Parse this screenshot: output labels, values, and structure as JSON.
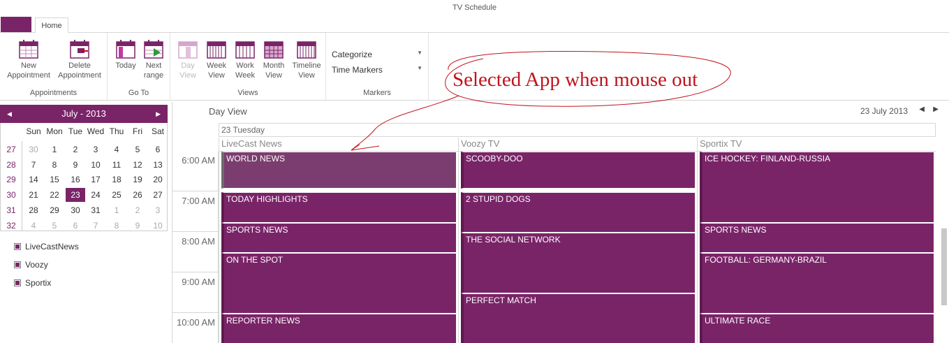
{
  "window": {
    "title": "TV Schedule"
  },
  "ribbon": {
    "tabs": [
      {
        "label": "Home"
      }
    ],
    "groups": {
      "appointments": {
        "label": "Appointments",
        "new_label": "New\nAppointment",
        "delete_label": "Delete\nAppointment"
      },
      "goto": {
        "label": "Go To",
        "today_label": "Today",
        "next_label": "Next\nrange"
      },
      "views": {
        "label": "Views",
        "day_label": "Day\nView",
        "week_label": "Week\nView",
        "workweek_label": "Work\nWeek",
        "month_label": "Month\nView",
        "timeline_label": "Timeline\nView"
      },
      "markers": {
        "label": "Markers",
        "categorize_label": "Categorize",
        "timemarkers_label": "Time Markers"
      }
    }
  },
  "mini_calendar": {
    "title": "July - 2013",
    "weekdays": [
      "Sun",
      "Mon",
      "Tue",
      "Wed",
      "Thu",
      "Fri",
      "Sat"
    ],
    "weeks": [
      {
        "num": "27",
        "days": [
          "30",
          "1",
          "2",
          "3",
          "4",
          "5",
          "6"
        ],
        "other": [
          true,
          false,
          false,
          false,
          false,
          false,
          false
        ]
      },
      {
        "num": "28",
        "days": [
          "7",
          "8",
          "9",
          "10",
          "11",
          "12",
          "13"
        ],
        "other": [
          false,
          false,
          false,
          false,
          false,
          false,
          false
        ]
      },
      {
        "num": "29",
        "days": [
          "14",
          "15",
          "16",
          "17",
          "18",
          "19",
          "20"
        ],
        "other": [
          false,
          false,
          false,
          false,
          false,
          false,
          false
        ]
      },
      {
        "num": "30",
        "days": [
          "21",
          "22",
          "23",
          "24",
          "25",
          "26",
          "27"
        ],
        "other": [
          false,
          false,
          false,
          false,
          false,
          false,
          false
        ]
      },
      {
        "num": "31",
        "days": [
          "28",
          "29",
          "30",
          "31",
          "1",
          "2",
          "3"
        ],
        "other": [
          false,
          false,
          false,
          false,
          true,
          true,
          true
        ]
      },
      {
        "num": "32",
        "days": [
          "4",
          "5",
          "6",
          "7",
          "8",
          "9",
          "10"
        ],
        "other": [
          true,
          true,
          true,
          true,
          true,
          true,
          true
        ]
      }
    ],
    "selected_day": "23"
  },
  "resources": [
    {
      "label": "LiveCastNews"
    },
    {
      "label": "Voozy"
    },
    {
      "label": "Sportix"
    }
  ],
  "scheduler": {
    "view_title": "Day View",
    "date_label": "23 July 2013",
    "day_header": "23 Tuesday",
    "columns": [
      {
        "name": "LiveCast News",
        "appointments": [
          {
            "title": "WORLD NEWS",
            "start": "6:00",
            "end": "6:55",
            "selected": true
          },
          {
            "title": "TODAY HIGHLIGHTS",
            "start": "7:00",
            "end": "7:45",
            "selected": false
          },
          {
            "title": "SPORTS NEWS",
            "start": "7:45",
            "end": "8:30",
            "selected": false
          },
          {
            "title": "ON THE SPOT",
            "start": "8:30",
            "end": "10:00",
            "selected": false
          },
          {
            "title": "REPORTER NEWS",
            "start": "10:00",
            "end": "11:00",
            "selected": false
          }
        ]
      },
      {
        "name": "Voozy TV",
        "appointments": [
          {
            "title": "SCOOBY-DOO",
            "start": "6:00",
            "end": "6:55",
            "selected": false
          },
          {
            "title": "2 STUPID DOGS",
            "start": "7:00",
            "end": "8:00",
            "selected": false
          },
          {
            "title": "THE SOCIAL NETWORK",
            "start": "8:00",
            "end": "9:30",
            "selected": false
          },
          {
            "title": "PERFECT MATCH",
            "start": "9:30",
            "end": "11:00",
            "selected": false
          }
        ]
      },
      {
        "name": "Sportix TV",
        "appointments": [
          {
            "title": "ICE HOCKEY: FINLAND-RUSSIA",
            "start": "6:00",
            "end": "7:45",
            "selected": false
          },
          {
            "title": "SPORTS NEWS",
            "start": "7:45",
            "end": "8:30",
            "selected": false
          },
          {
            "title": "FOOTBALL: GERMANY-BRAZIL",
            "start": "8:30",
            "end": "10:00",
            "selected": false
          },
          {
            "title": "ULTIMATE RACE",
            "start": "10:00",
            "end": "11:00",
            "selected": false
          }
        ]
      }
    ],
    "times": [
      "6:00 AM",
      "7:00 AM",
      "8:00 AM",
      "9:00 AM",
      "10:00 AM"
    ]
  },
  "annotation": {
    "text": "Selected App when mouse out"
  },
  "colors": {
    "accent": "#7a2468",
    "selected": "#7b3d6f",
    "annotation": "#c0141c"
  }
}
